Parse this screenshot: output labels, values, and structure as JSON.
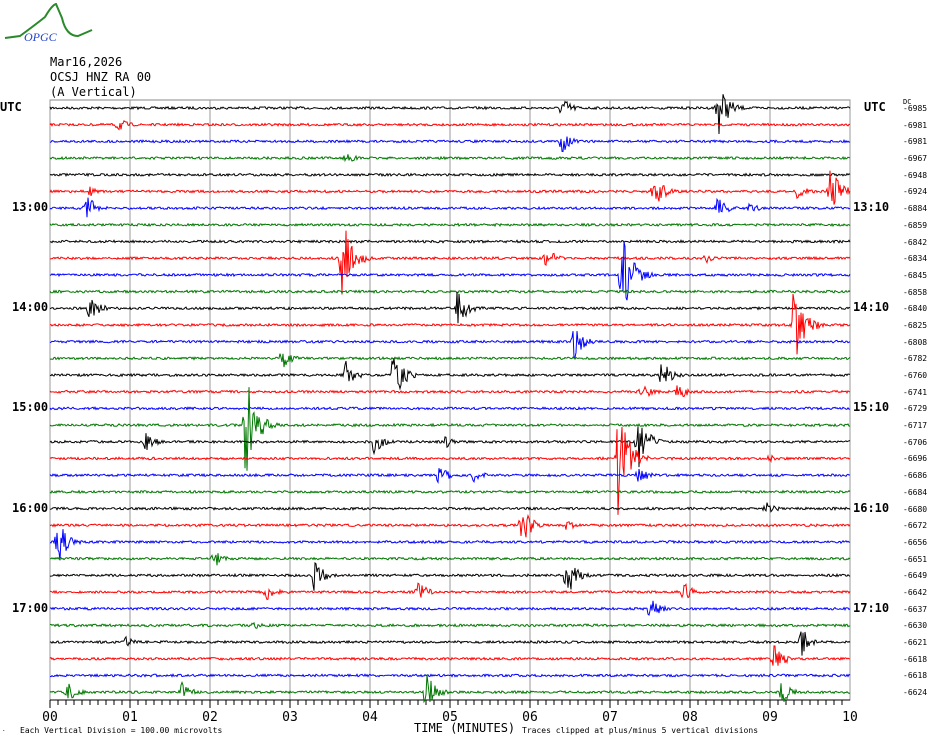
{
  "logo": {
    "text": "OPGC"
  },
  "header": {
    "date": "Mar16,2026",
    "station": "OCSJ HNZ RA 00",
    "component": "(A Vertical)"
  },
  "utc_left": "UTC",
  "utc_right": "UTC",
  "dc_label": "DC",
  "chart_data": {
    "type": "line",
    "title": "OCSJ HNZ RA 00 helicorder",
    "xlabel": "TIME (MINUTES)",
    "xlim": [
      0,
      10
    ],
    "x_ticks": [
      "00",
      "01",
      "02",
      "03",
      "04",
      "05",
      "06",
      "07",
      "08",
      "09",
      "10"
    ],
    "colors": [
      "#000000",
      "#ff0000",
      "#0000ff",
      "#007700"
    ],
    "left_labels": [
      {
        "row": 6,
        "text": "13:00"
      },
      {
        "row": 12,
        "text": "14:00"
      },
      {
        "row": 18,
        "text": "15:00"
      },
      {
        "row": 24,
        "text": "16:00"
      },
      {
        "row": 30,
        "text": "17:00"
      }
    ],
    "right_labels": [
      {
        "row": 6,
        "text": "13:10"
      },
      {
        "row": 12,
        "text": "14:10"
      },
      {
        "row": 18,
        "text": "15:10"
      },
      {
        "row": 24,
        "text": "16:10"
      },
      {
        "row": 30,
        "text": "17:10"
      }
    ],
    "dc_offsets": [
      "-6985",
      "-6981",
      "-6981",
      "-6967",
      "-6948",
      "-6924",
      "-6884",
      "-6859",
      "-6842",
      "-6834",
      "-6845",
      "-6858",
      "-6840",
      "-6825",
      "-6808",
      "-6782",
      "-6760",
      "-6741",
      "-6729",
      "-6717",
      "-6706",
      "-6696",
      "-6686",
      "-6684",
      "-6680",
      "-6672",
      "-6656",
      "-6651",
      "-6649",
      "-6642",
      "-6637",
      "-6630",
      "-6621",
      "-6618",
      "-6618",
      "-6624"
    ],
    "events": [
      [
        0,
        6.4,
        12
      ],
      [
        0,
        8.35,
        30
      ],
      [
        1,
        0.85,
        8
      ],
      [
        2,
        6.4,
        12
      ],
      [
        3,
        3.7,
        6
      ],
      [
        5,
        0.5,
        5
      ],
      [
        5,
        7.55,
        18
      ],
      [
        5,
        9.35,
        10
      ],
      [
        5,
        9.75,
        30
      ],
      [
        6,
        0.45,
        15
      ],
      [
        6,
        8.35,
        12
      ],
      [
        6,
        8.75,
        6
      ],
      [
        9,
        3.65,
        50
      ],
      [
        9,
        6.2,
        12
      ],
      [
        9,
        8.2,
        5
      ],
      [
        10,
        7.15,
        60
      ],
      [
        12,
        0.5,
        15
      ],
      [
        12,
        5.1,
        25
      ],
      [
        13,
        9.3,
        50
      ],
      [
        14,
        6.55,
        18
      ],
      [
        15,
        2.9,
        12
      ],
      [
        16,
        3.7,
        15
      ],
      [
        16,
        4.3,
        30
      ],
      [
        16,
        7.65,
        15
      ],
      [
        17,
        7.4,
        10
      ],
      [
        17,
        7.85,
        10
      ],
      [
        19,
        2.45,
        60
      ],
      [
        20,
        1.2,
        10
      ],
      [
        20,
        4.05,
        12
      ],
      [
        20,
        4.95,
        8
      ],
      [
        20,
        7.35,
        30
      ],
      [
        21,
        7.1,
        70
      ],
      [
        21,
        9.0,
        5
      ],
      [
        22,
        4.85,
        12
      ],
      [
        22,
        5.3,
        8
      ],
      [
        22,
        7.35,
        10
      ],
      [
        24,
        8.95,
        8
      ],
      [
        25,
        5.9,
        20
      ],
      [
        25,
        6.45,
        6
      ],
      [
        26,
        0.1,
        25
      ],
      [
        27,
        2.05,
        10
      ],
      [
        28,
        3.3,
        18
      ],
      [
        28,
        6.45,
        25
      ],
      [
        29,
        2.7,
        10
      ],
      [
        29,
        4.6,
        12
      ],
      [
        29,
        7.9,
        12
      ],
      [
        30,
        7.5,
        12
      ],
      [
        31,
        2.55,
        5
      ],
      [
        32,
        0.95,
        6
      ],
      [
        32,
        9.4,
        15
      ],
      [
        33,
        9.05,
        15
      ],
      [
        35,
        0.2,
        12
      ],
      [
        35,
        1.65,
        10
      ],
      [
        35,
        4.7,
        20
      ],
      [
        35,
        9.15,
        12
      ]
    ]
  },
  "footer": {
    "scale": "Each Vertical Division =  100.00 microvolts",
    "xlabel": "TIME (MINUTES)",
    "clip": "Traces clipped at plus/minus 5 vertical divisions"
  }
}
